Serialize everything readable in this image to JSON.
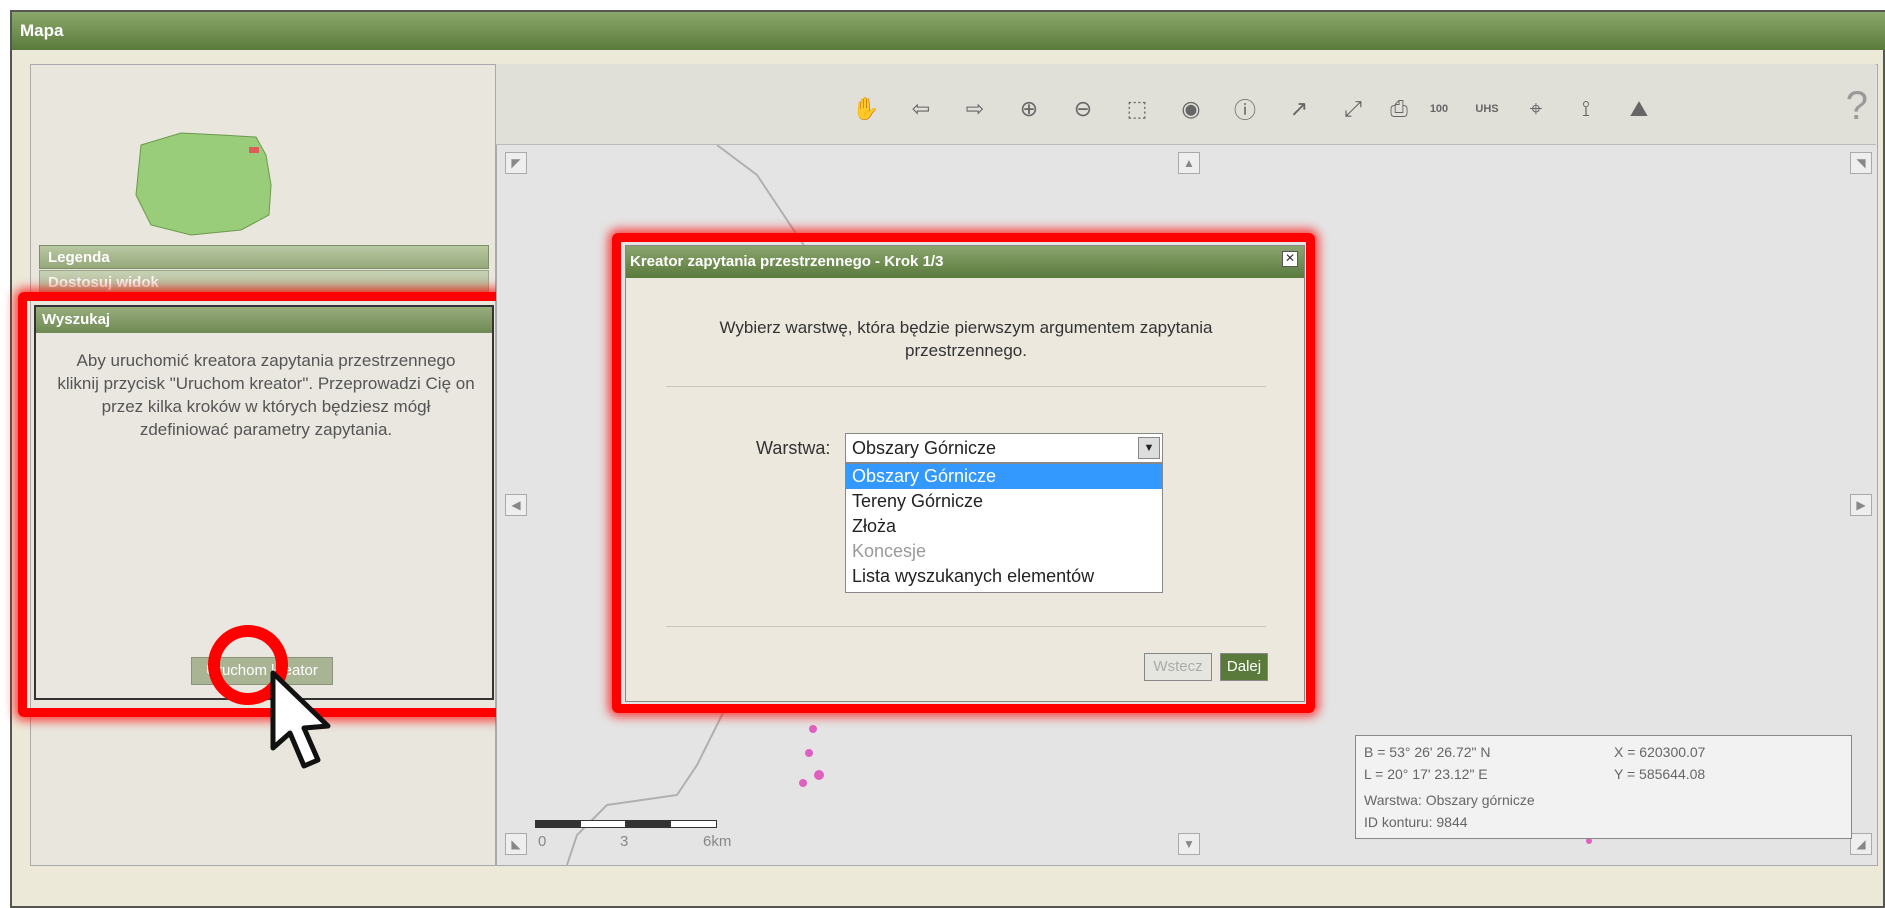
{
  "window": {
    "title": "Mapa"
  },
  "sidebar": {
    "sections": [
      "Legenda",
      "Dostosuj widok"
    ],
    "search": {
      "title": "Wyszukaj",
      "description": "Aby uruchomić kreatora zapytania przestrzennego kliknij przycisk \"Uruchom kreator\". Przeprowadzi Cię on przez kilka kroków w których będziesz mógł zdefiniować parametry zapytania.",
      "start_button": "Uruchom kreator"
    }
  },
  "toolbar": {
    "tools": [
      "pan-icon",
      "back-icon",
      "forward-icon",
      "zoom-in-icon",
      "zoom-out-icon",
      "zoom-box-icon",
      "zoom-extent-icon",
      "info-icon",
      "measure-icon",
      "measure-area-icon",
      "print-icon",
      "scale-100-icon",
      "uhs-icon",
      "coord-icon",
      "polyline-icon",
      "layers-icon"
    ],
    "help": "?"
  },
  "dialog": {
    "title": "Kreator zapytania przestrzennego - Krok 1/3",
    "instruction": "Wybierz warstwę, która będzie pierwszym argumentem zapytania przestrzennego.",
    "layer_label": "Warstwa:",
    "selected": "Obszary Górnicze",
    "options": [
      "Obszary Górnicze",
      "Tereny Górnicze",
      "Złoża",
      "Koncesje",
      "Lista wyszukanych elementów"
    ],
    "back_button": "Wstecz",
    "next_button": "Dalej"
  },
  "coords": {
    "b": "B = 53° 26' 26.72\" N",
    "l": "L = 20° 17' 23.12\" E",
    "x": "X = 620300.07",
    "y": "Y = 585644.08",
    "layer": "Warstwa: Obszary górnicze",
    "id": "ID konturu: 9844"
  },
  "scale": {
    "t0": "0",
    "t1": "3",
    "t2": "6km"
  },
  "colors": {
    "accent": "#5a7a3c",
    "highlight": "#ff0000",
    "selection": "#3399ff"
  }
}
